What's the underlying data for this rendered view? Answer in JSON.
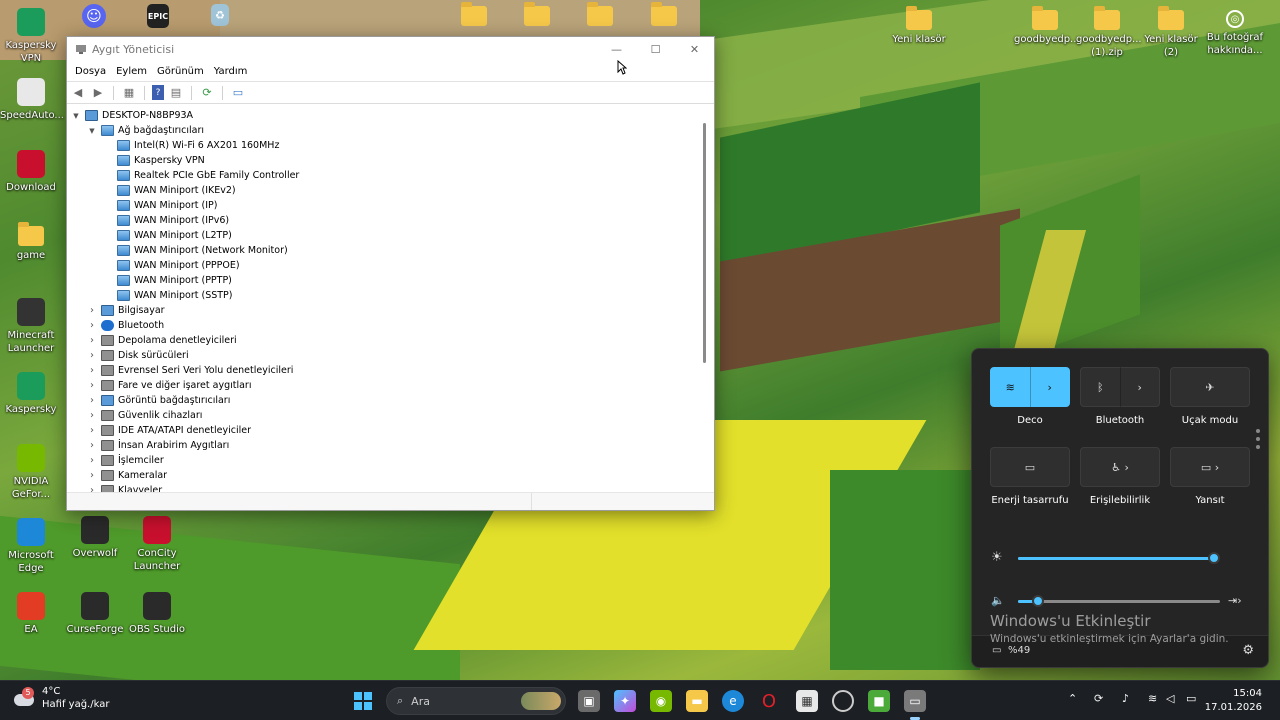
{
  "desktop": {
    "left_icons": [
      {
        "name": "Kaspersky VPN",
        "label": "Kaspersky\nVPN",
        "color": "#1c9c5a"
      },
      {
        "name": "SpeedAuto",
        "label": "SpeedAuto...",
        "color": "#e8e8e8"
      },
      {
        "name": "Download",
        "label": "Download",
        "color": "#c8102e"
      },
      {
        "name": "game",
        "label": "game",
        "color": "#f5c84a"
      },
      {
        "name": "Minecraft Launcher",
        "label": "Minecraft\nLauncher",
        "color": "#333333"
      },
      {
        "name": "Kaspersky",
        "label": "Kaspersky",
        "color": "#1c9c5a"
      },
      {
        "name": "NVIDIA GeForce",
        "label": "NVIDIA\nGeFor...",
        "color": "#76b900"
      },
      {
        "name": "Microsoft Edge",
        "label": "Microsoft\nEdge",
        "color": "#1e88d8"
      },
      {
        "name": "EA",
        "label": "EA",
        "color": "#e23c25"
      }
    ],
    "second_column": [
      {
        "label": "Overwolf",
        "color": "#2a2a2a"
      },
      {
        "label": "ConCity\nLauncher",
        "color": "#c8102e"
      },
      {
        "label": "CurseForge",
        "color": "#2a2a2a"
      },
      {
        "label": "OBS Studio",
        "color": "#2a2a2a"
      }
    ],
    "top_icons": [
      {
        "label": "Yeni klasör"
      },
      {
        "label": "goodbyedp..."
      },
      {
        "label": "goodbyedp...\n(1).zip"
      },
      {
        "label": "Yeni klasör\n(2)"
      },
      {
        "label": "Bu fotoğraf\nhakkında..."
      }
    ]
  },
  "device_manager": {
    "title": "Aygıt Yöneticisi",
    "menu": [
      "Dosya",
      "Eylem",
      "Görünüm",
      "Yardım"
    ],
    "root": "DESKTOP-N8BP93A",
    "network_group": "Ağ bağdaştırıcıları",
    "network_adapters": [
      "Intel(R) Wi-Fi 6 AX201 160MHz",
      "Kaspersky VPN",
      "Realtek PCIe GbE Family Controller",
      "WAN Miniport (IKEv2)",
      "WAN Miniport (IP)",
      "WAN Miniport (IPv6)",
      "WAN Miniport (L2TP)",
      "WAN Miniport (Network Monitor)",
      "WAN Miniport (PPPOE)",
      "WAN Miniport (PPTP)",
      "WAN Miniport (SSTP)"
    ],
    "categories": [
      "Bilgisayar",
      "Bluetooth",
      "Depolama denetleyicileri",
      "Disk sürücüleri",
      "Evrensel Seri Veri Yolu denetleyicileri",
      "Fare ve diğer işaret aygıtları",
      "Görüntü bağdaştırıcıları",
      "Güvenlik cihazları",
      "IDE ATA/ATAPI denetleyiciler",
      "İnsan Arabirim Aygıtları",
      "İşlemciler",
      "Kameralar",
      "Klavyeler"
    ]
  },
  "quick_settings": {
    "tiles": [
      {
        "label": "Deco",
        "icon": "wifi-icon",
        "active": true
      },
      {
        "label": "Bluetooth",
        "icon": "bluetooth-icon",
        "active": false
      },
      {
        "label": "Uçak modu",
        "icon": "airplane-icon",
        "active": false
      },
      {
        "label": "Enerji tasarrufu",
        "icon": "battery-saver-icon",
        "active": false
      },
      {
        "label": "Erişilebilirlik",
        "icon": "accessibility-icon",
        "active": false
      },
      {
        "label": "Yansıt",
        "icon": "cast-icon",
        "active": false
      }
    ],
    "brightness": 0.98,
    "volume": 0.1,
    "battery": "%49",
    "activation_title": "Windows'u Etkinleştir",
    "activation_text": "Windows'u etkinleştirmek için Ayarlar'a gidin."
  },
  "taskbar": {
    "weather_temp": "4°C",
    "weather_desc": "Hafif yağ./kar",
    "weather_badge": "5",
    "search_placeholder": "Ara",
    "time": "15:04",
    "date": "17.01.2026"
  },
  "colors": {
    "accent": "#4cc2ff",
    "taskbar": "#1c1f23",
    "panel": "#252525"
  }
}
